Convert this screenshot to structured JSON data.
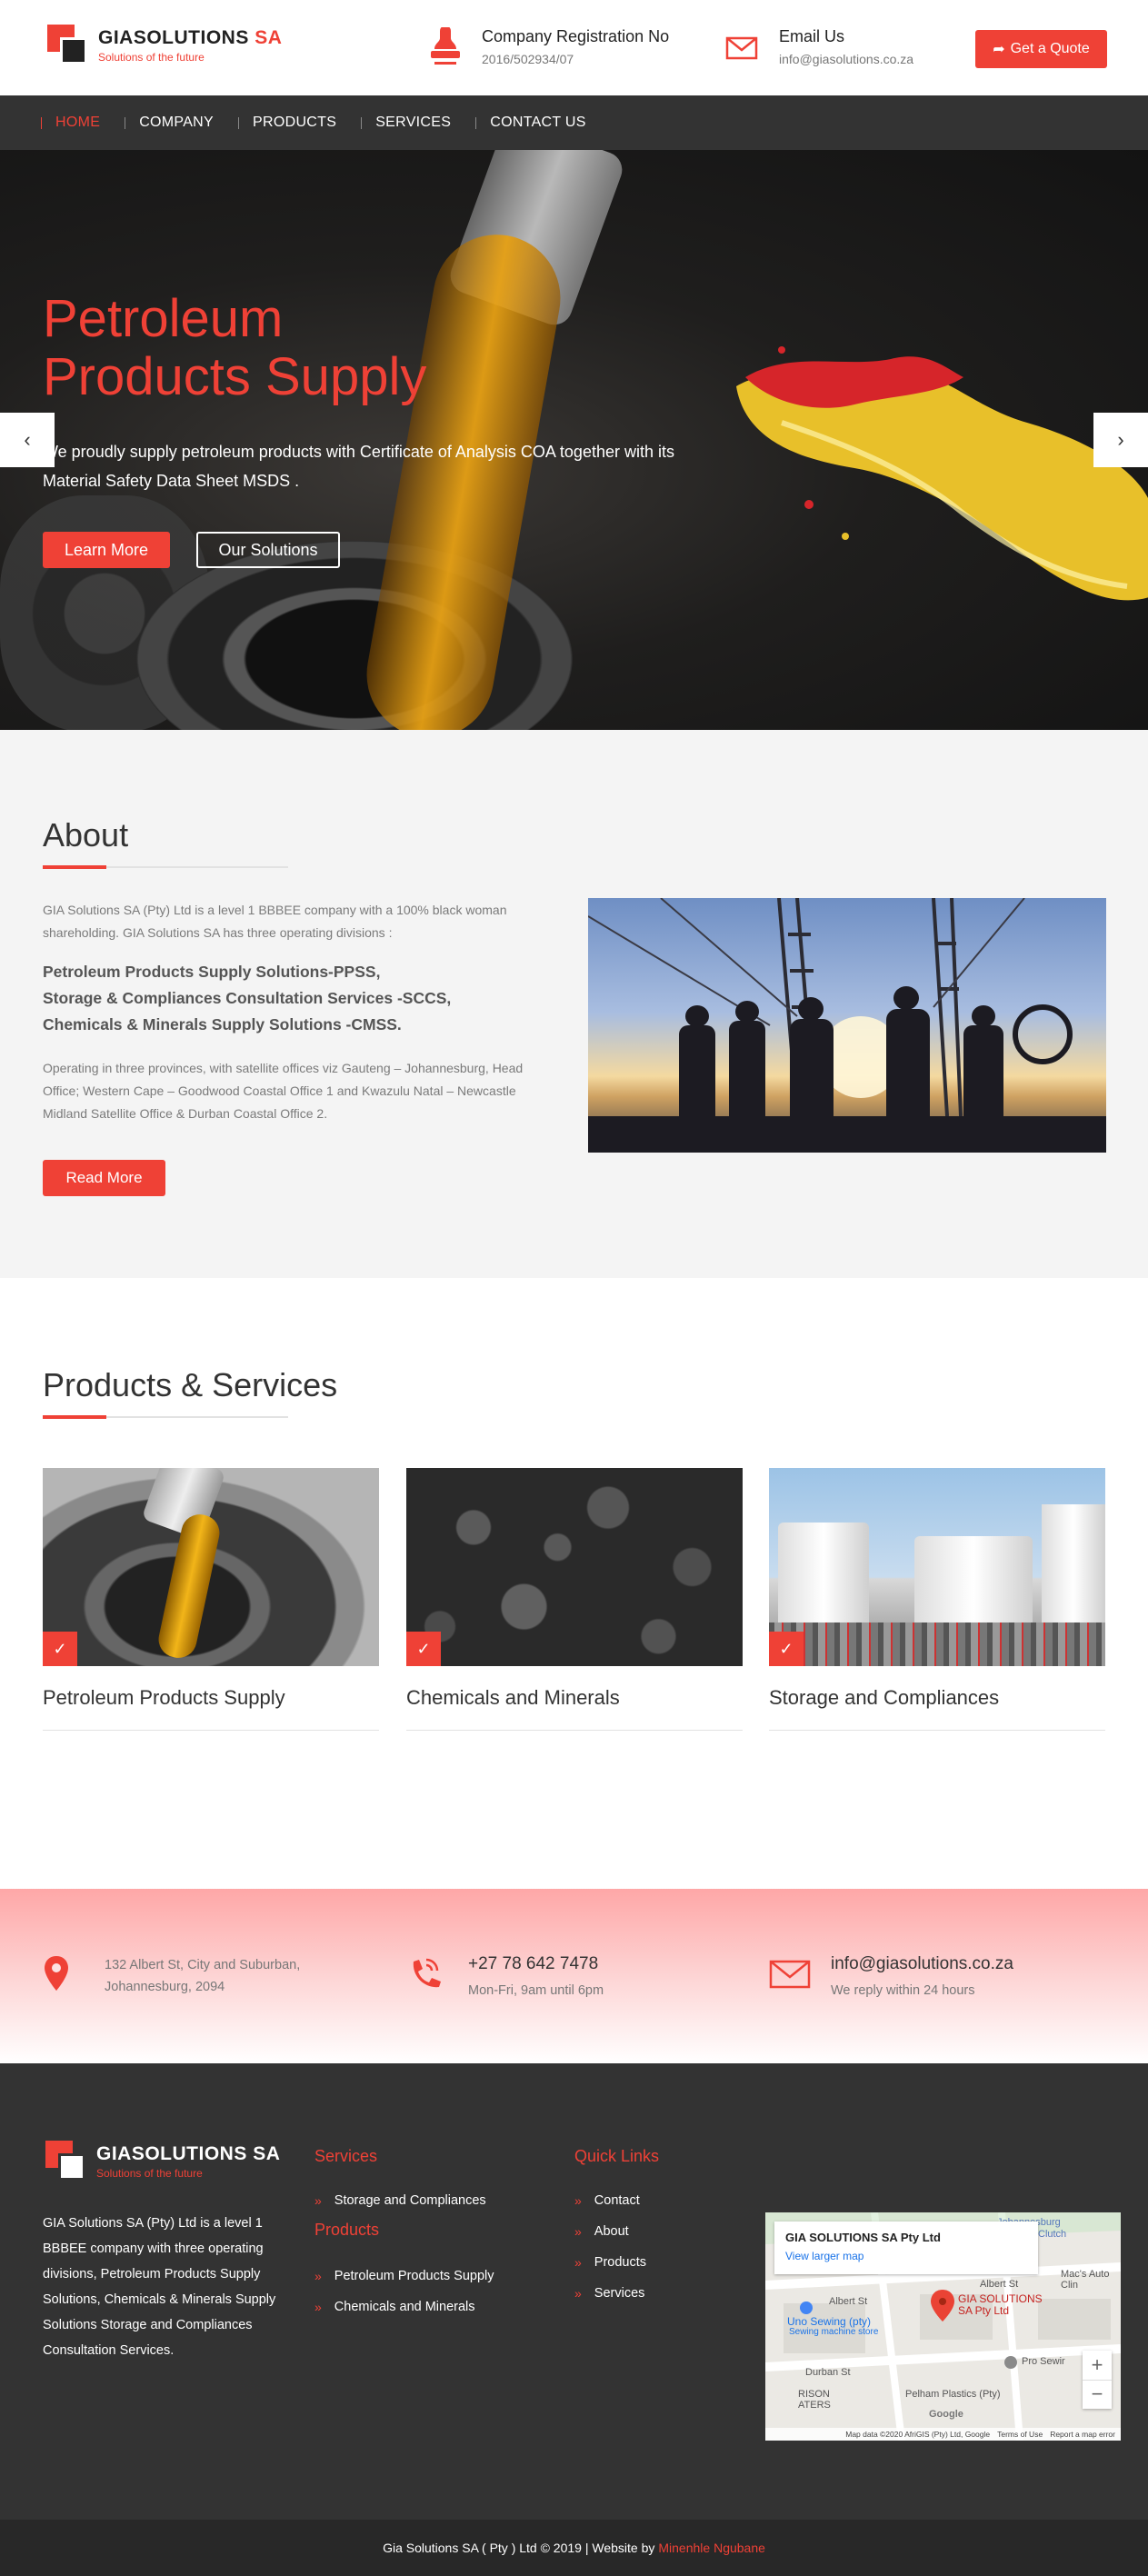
{
  "header": {
    "logo_name": "GIASOLUTIONS",
    "logo_suffix": "SA",
    "logo_tagline": "Solutions of the future",
    "registration_label": "Company Registration No",
    "registration_value": "2016/502934/07",
    "email_label": "Email Us",
    "email_value": "info@giasolutions.co.za",
    "quote_button": "Get a Quote"
  },
  "nav": {
    "items": [
      "HOME",
      "COMPANY",
      "PRODUCTS",
      "SERVICES",
      "CONTACT US"
    ],
    "active": "HOME"
  },
  "hero": {
    "title_line1": "Petroleum",
    "title_line2": "Products Supply",
    "description": "We proudly supply petroleum products with Certificate of Analysis COA together with its Material Safety Data Sheet MSDS .",
    "button_primary": "Learn More",
    "button_secondary": "Our Solutions"
  },
  "about": {
    "title": "About",
    "intro": "GIA Solutions SA (Pty) Ltd is a level 1 BBBEE company with a 100% black woman shareholding. GIA Solutions SA has three operating divisions :",
    "divisions": [
      "Petroleum Products Supply Solutions-PPSS,",
      "Storage & Compliances Consultation Services -SCCS,",
      "Chemicals & Minerals Supply Solutions -CMSS."
    ],
    "offices": "Operating in three provinces, with satellite offices viz Gauteng – Johannesburg, Head Office; Western Cape – Goodwood Coastal Office 1 and Kwazulu Natal – Newcastle Midland Satellite Office & Durban Coastal Office 2.",
    "button": "Read More"
  },
  "products": {
    "title": "Products & Services",
    "cards": [
      {
        "title": "Petroleum Products Supply"
      },
      {
        "title": "Chemicals and Minerals"
      },
      {
        "title": "Storage and Compliances"
      }
    ]
  },
  "contact": {
    "address_line1": "132 Albert St, City and Suburban,",
    "address_line2": "Johannesburg, 2094",
    "phone": "+27 78 642 7478",
    "phone_hours": "Mon-Fri, 9am until 6pm",
    "email": "info@giasolutions.co.za",
    "email_note": "We reply within 24 hours"
  },
  "footer": {
    "logo_name": "GIASOLUTIONS",
    "logo_suffix": "SA",
    "logo_tagline": "Solutions of the future",
    "about": "GIA Solutions SA (Pty) Ltd is a level 1 BBBEE company with three operating divisions, Petroleum Products Supply Solutions, Chemicals & Minerals Supply Solutions Storage and Compliances Consultation Services.",
    "services_heading": "Services",
    "services": [
      "Storage and Compliances"
    ],
    "products_heading": "Products",
    "products": [
      "Petroleum Products Supply",
      "Chemicals and Minerals"
    ],
    "quick_links_heading": "Quick Links",
    "quick_links": [
      "Contact",
      "About",
      "Products",
      "Services"
    ],
    "map": {
      "place_name": "GIA SOLUTIONS SA Pty Ltd",
      "larger_map": "View larger map",
      "pin_label_line1": "GIA SOLUTIONS",
      "pin_label_line2": "SA Pty Ltd",
      "labels": [
        "Albert St",
        "Albert St",
        "Mac's Auto Clin",
        "Uno Sewing (pty)",
        "Sewing machine store",
        "Pro Sewir",
        "Durban St",
        "Pelham Plastics (Pty)",
        "Johannesburg",
        "Clutch",
        "RISON",
        "ATERS"
      ],
      "attribution": "Map data ©2020 AfriGIS (Pty) Ltd, Google",
      "terms": "Terms of Use",
      "report": "Report a map error",
      "google": "Google"
    }
  },
  "bottom": {
    "copyright": "Gia Solutions SA ( Pty ) Ltd © 2019 | Website by",
    "author": "Minenhle Ngubane"
  },
  "colors": {
    "accent": "#ef4136",
    "dark": "#333333",
    "footer_bottom": "#282828",
    "section_bg": "#f4f4f4"
  },
  "icons": {
    "registration": "stamp-icon",
    "email": "envelope-icon",
    "quote": "share-arrow-icon",
    "address": "map-marker-icon",
    "phone": "phone-ringing-icon",
    "card_check": "check-icon",
    "list": "double-chevron-icon",
    "slider_prev": "chevron-left-icon",
    "slider_next": "chevron-right-icon"
  }
}
